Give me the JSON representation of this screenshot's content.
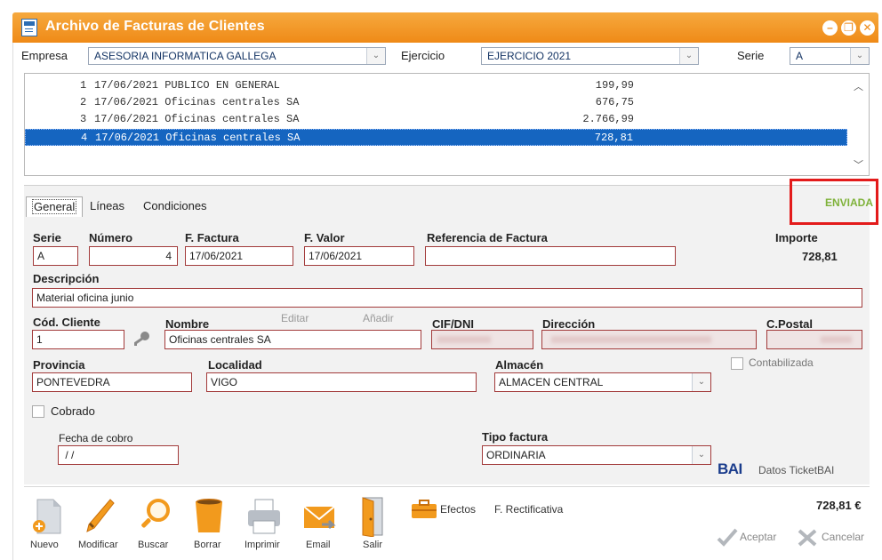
{
  "window": {
    "title": "Archivo de Facturas de Clientes",
    "minimize_glyph": "–",
    "restore_glyph": "❐",
    "close_glyph": "✕"
  },
  "filters": {
    "empresa_label": "Empresa",
    "empresa_value": "ASESORIA INFORMATICA GALLEGA",
    "ejercicio_label": "Ejercicio",
    "ejercicio_value": "EJERCICIO 2021",
    "serie_label": "Serie",
    "serie_value": "A"
  },
  "invoice_list": [
    {
      "n": "1",
      "text": "17/06/2021 PUBLICO EN GENERAL",
      "amount": "199,99"
    },
    {
      "n": "2",
      "text": "17/06/2021 Oficinas centrales SA",
      "amount": "676,75"
    },
    {
      "n": "3",
      "text": "17/06/2021 Oficinas centrales SA",
      "amount": "2.766,99"
    },
    {
      "n": "4",
      "text": "17/06/2021 Oficinas centrales SA",
      "amount": "728,81"
    }
  ],
  "tabs": {
    "general": "General",
    "lineas": "Líneas",
    "condiciones": "Condiciones"
  },
  "status": "ENVIADA",
  "form": {
    "serie_label": "Serie",
    "serie_value": "A",
    "numero_label": "Número",
    "numero_value": "4",
    "ffactura_label": "F. Factura",
    "ffactura_value": "17/06/2021",
    "fvalor_label": "F. Valor",
    "fvalor_value": "17/06/2021",
    "referencia_label": "Referencia de Factura",
    "referencia_value": "",
    "importe_label": "Importe",
    "importe_value": "728,81",
    "descripcion_label": "Descripción",
    "descripcion_value": "Material oficina junio",
    "codcliente_label": "Cód. Cliente",
    "codcliente_value": "1",
    "nombre_label": "Nombre",
    "editar_label": "Editar",
    "anadir_label": "Añadir",
    "nombre_value": "Oficinas centrales SA",
    "cif_label": "CIF/DNI",
    "direccion_label": "Dirección",
    "cpostal_label": "C.Postal",
    "provincia_label": "Provincia",
    "provincia_value": "PONTEVEDRA",
    "localidad_label": "Localidad",
    "localidad_value": "VIGO",
    "almacen_label": "Almacén",
    "almacen_value": "ALMACEN CENTRAL",
    "contabilizada_label": "Contabilizada",
    "cobrado_label": "Cobrado",
    "fechacobro_label": "Fecha de cobro",
    "fechacobro_value": " / /",
    "tipofactura_label": "Tipo factura",
    "tipofactura_value": "ORDINARIA",
    "ticketbai_logo": "BAI",
    "ticketbai_label": "Datos TicketBAI"
  },
  "toolbar": {
    "nuevo": "Nuevo",
    "modificar": "Modificar",
    "buscar": "Buscar",
    "borrar": "Borrar",
    "imprimir": "Imprimir",
    "email": "Email",
    "salir": "Salir",
    "efectos": "Efectos",
    "rectificativa": "F. Rectificativa",
    "total": "728,81 €",
    "aceptar": "Aceptar",
    "cancelar": "Cancelar"
  }
}
